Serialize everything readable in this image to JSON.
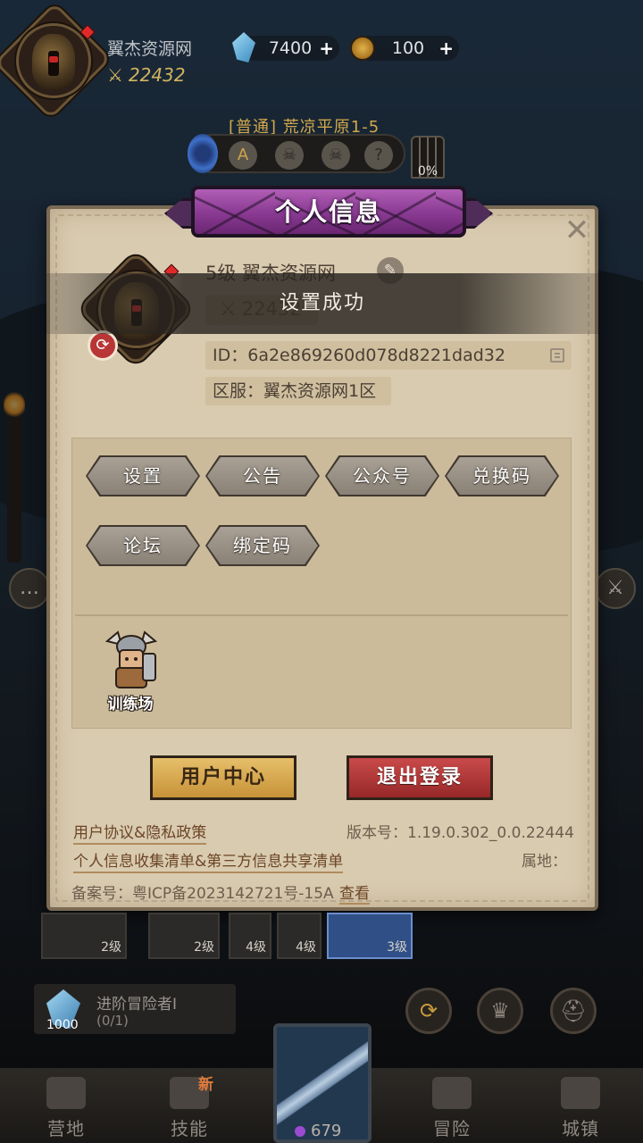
{
  "hud": {
    "player_name": "翼杰资源网",
    "power": "22432",
    "gems": "7400",
    "coins": "100",
    "stage": "[普通] 荒凉平原1-5",
    "stage_nodes": [
      "A",
      "☠",
      "☠",
      "?"
    ],
    "boss_progress": "0%"
  },
  "panel": {
    "title": "个人信息",
    "level_name": "5级  翼杰资源网",
    "power": "22432",
    "toast": "设置成功",
    "id": "ID：6a2e869260d078d8221dad32",
    "server": "区服：翼杰资源网1区",
    "buttons": {
      "settings": "设置",
      "notice": "公告",
      "official": "公众号",
      "redeem": "兑换码",
      "forum": "论坛",
      "bind": "绑定码"
    },
    "training_label": "训练场",
    "user_center": "用户中心",
    "logout": "退出登录",
    "agreement": "用户协议&隐私政策",
    "version": "版本号：1.19.0.302_0.0.22444",
    "info_list": "个人信息收集清单&第三方信息共享清单",
    "location": "属地：",
    "icp": "备案号：粤ICP备2023142721号-15A",
    "icp_view": "查看"
  },
  "slots": [
    {
      "level": "2级"
    },
    {
      "level": "2级"
    },
    {
      "level": "4级"
    },
    {
      "level": "4级"
    },
    {
      "level": "3级"
    }
  ],
  "quest": {
    "title": "进阶冒险者Ⅰ",
    "progress": "(0/1)",
    "reward": "1000"
  },
  "nav": {
    "camp": "营地",
    "skills": "技能",
    "skills_badge": "新",
    "adventure": "冒险",
    "town": "城镇",
    "center_count": "679"
  },
  "colors": {
    "panel_bg": "#d9cbb0",
    "ribbon": "#8c3c95",
    "gold_button": "#d9aa52",
    "red_button": "#b23636",
    "hex_button": "#9a9186"
  }
}
